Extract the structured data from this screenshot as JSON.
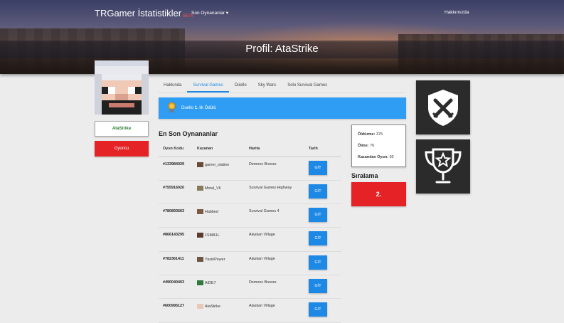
{
  "nav": {
    "brand": "TRGamer İstatistikler",
    "beta": "BETA",
    "recent": "Son Oynananlar",
    "about": "Hakkımızda"
  },
  "profile": {
    "title": "Profil: AtaStrike",
    "name": "AtaStrike",
    "role": "Oyuncu"
  },
  "tabs": [
    "Hakkında",
    "Survival Games",
    "Düello",
    "Sky Wars",
    "Solo Survival Games"
  ],
  "award": {
    "text_prefix": "Duello ",
    "text_bold": "1",
    "text_suffix": ". lik Ödülü"
  },
  "recent": {
    "title": "En Son Oynananlar",
    "columns": [
      "Oyun Kodu",
      "Kazanan",
      "Harita",
      "Tarih"
    ],
    "go_label": "GİT",
    "rows": [
      {
        "code": "#133984029",
        "winner": "gamer_station",
        "map": "Demons Breeze"
      },
      {
        "code": "#755916020",
        "winner": "Metal_Vll",
        "map": "Survival Games Highway"
      },
      {
        "code": "#780893663",
        "winner": "Habbed",
        "map": "Survival Games 4"
      },
      {
        "code": "#866143295",
        "winner": "1SMA1L",
        "map": "Alaskan Village"
      },
      {
        "code": "#782361411",
        "winner": "YasinPower",
        "map": "Alaskan Village"
      },
      {
        "code": "#490040403",
        "winner": "AIDE7",
        "map": "Demons Breeze"
      },
      {
        "code": "#600995127",
        "winner": "AtaStrike",
        "map": "Alaskan Village"
      }
    ]
  },
  "stats": {
    "kills_label": "Öldürme:",
    "kills": "375",
    "deaths_label": "Ölme:",
    "deaths": "76",
    "wins_label": "Kazanılan Oyun:",
    "wins": "92"
  },
  "ranking": {
    "title": "Sıralama",
    "value": "2."
  },
  "icons": [
    "medal-icon",
    "crossed-swords-shield-icon",
    "trophy-star-icon",
    "caret-down-icon"
  ]
}
